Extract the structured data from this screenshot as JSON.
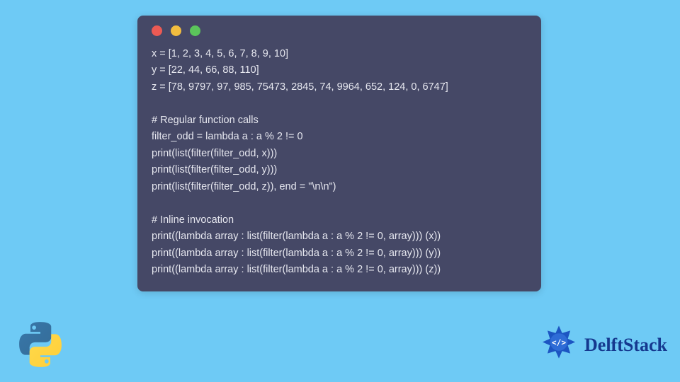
{
  "code_lines": [
    "x = [1, 2, 3, 4, 5, 6, 7, 8, 9, 10]",
    "y = [22, 44, 66, 88, 110]",
    "z = [78, 9797, 97, 985, 75473, 2845, 74, 9964, 652, 124, 0, 6747]",
    "",
    "# Regular function calls",
    "filter_odd = lambda a : a % 2 != 0",
    "print(list(filter(filter_odd, x)))",
    "print(list(filter(filter_odd, y)))",
    "print(list(filter(filter_odd, z)), end = \"\\n\\n\")",
    "",
    "# Inline invocation",
    "print((lambda array : list(filter(lambda a : a % 2 != 0, array))) (x))",
    "print((lambda array : list(filter(lambda a : a % 2 != 0, array))) (y))",
    "print((lambda array : list(filter(lambda a : a % 2 != 0, array))) (z))"
  ],
  "brand_text": "DelftStack",
  "traffic_light_colors": {
    "red": "#ec5a54",
    "yellow": "#f2bd3f",
    "green": "#5bc55b"
  },
  "window_bg": "#454866",
  "page_bg": "#6ecaf5"
}
